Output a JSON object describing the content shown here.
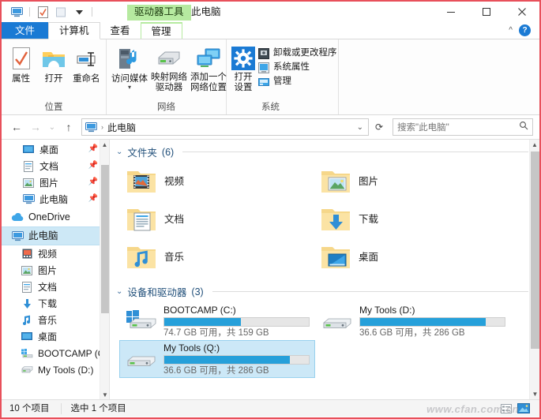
{
  "window": {
    "title": "此电脑",
    "contextual_tab_header": "驱动器工具",
    "accent_blue": "#1a7ad4",
    "contextual_green": "#b6eaa0",
    "selection_blue": "#cce8f7",
    "progress_blue": "#26a0da",
    "controls": {
      "minimize": "最小化",
      "maximize": "最大化",
      "close": "关闭"
    },
    "quick_access": [
      {
        "name": "this-pc-icon",
        "tooltip": "此电脑"
      },
      {
        "name": "properties-icon",
        "tooltip": "属性"
      },
      {
        "name": "new-folder-icon",
        "tooltip": "新建文件夹"
      },
      {
        "name": "customize-dropdown-icon",
        "tooltip": "自定义快速访问工具栏"
      }
    ]
  },
  "ribbon": {
    "tabs": [
      {
        "label": "文件",
        "state": "file"
      },
      {
        "label": "计算机",
        "state": "active"
      },
      {
        "label": "查看",
        "state": "normal"
      },
      {
        "label": "管理",
        "state": "contextual"
      }
    ],
    "collapse_label": "^",
    "help_label": "?",
    "groups": [
      {
        "label": "位置",
        "buttons": [
          {
            "label": "属性",
            "icon": "properties-icon"
          },
          {
            "label": "打开",
            "icon": "open-folder-icon"
          },
          {
            "label": "重命名",
            "icon": "rename-icon"
          }
        ]
      },
      {
        "label": "网络",
        "buttons": [
          {
            "label": "访问媒体",
            "label2": "",
            "icon": "access-media-icon",
            "has_caret": true
          },
          {
            "label": "映射网络",
            "label2": "驱动器",
            "icon": "map-network-drive-icon",
            "has_caret": true
          },
          {
            "label": "添加一个",
            "label2": "网络位置",
            "icon": "add-network-location-icon",
            "has_caret": false
          }
        ]
      },
      {
        "label": "系统",
        "big_button": {
          "label": "打开",
          "label2": "设置",
          "icon": "settings-gear-icon"
        },
        "small_items": [
          {
            "label": "卸载或更改程序",
            "icon": "uninstall-program-icon"
          },
          {
            "label": "系统属性",
            "icon": "system-properties-icon"
          },
          {
            "label": "管理",
            "icon": "manage-icon"
          }
        ]
      }
    ]
  },
  "address_bar": {
    "back": "后退",
    "forward": "前进",
    "recent": "最近浏览的位置",
    "up": "向上",
    "crumb_icon": "this-pc-icon",
    "crumb": "此电脑",
    "crumb_separator": "›",
    "dropdown": "⌄",
    "refresh": "刷新",
    "search_placeholder": "搜索\"此电脑\"",
    "search_icon": "search-icon"
  },
  "sidebar": {
    "items": [
      {
        "label": "桌面",
        "icon": "desktop-icon",
        "pinned": true,
        "level": 1,
        "selected": false
      },
      {
        "label": "文档",
        "icon": "documents-icon",
        "pinned": true,
        "level": 1,
        "selected": false
      },
      {
        "label": "图片",
        "icon": "pictures-icon",
        "pinned": true,
        "level": 1,
        "selected": false
      },
      {
        "label": "此电脑",
        "icon": "this-pc-icon",
        "pinned": true,
        "level": 1,
        "selected": false
      },
      {
        "label": "OneDrive",
        "icon": "onedrive-icon",
        "pinned": false,
        "level": 0,
        "selected": false
      },
      {
        "label": "此电脑",
        "icon": "this-pc-icon",
        "pinned": false,
        "level": 0,
        "selected": true
      },
      {
        "label": "视频",
        "icon": "videos-icon",
        "pinned": false,
        "level": 1,
        "selected": false
      },
      {
        "label": "图片",
        "icon": "pictures-icon",
        "pinned": false,
        "level": 1,
        "selected": false
      },
      {
        "label": "文档",
        "icon": "documents-icon",
        "pinned": false,
        "level": 1,
        "selected": false
      },
      {
        "label": "下载",
        "icon": "downloads-icon",
        "pinned": false,
        "level": 1,
        "selected": false
      },
      {
        "label": "音乐",
        "icon": "music-icon",
        "pinned": false,
        "level": 1,
        "selected": false
      },
      {
        "label": "桌面",
        "icon": "desktop-icon",
        "pinned": false,
        "level": 1,
        "selected": false
      },
      {
        "label": "BOOTCAMP (C",
        "icon": "windows-drive-icon",
        "pinned": false,
        "level": 1,
        "selected": false
      },
      {
        "label": "My Tools (D:)",
        "icon": "drive-icon",
        "pinned": false,
        "level": 1,
        "selected": false
      }
    ]
  },
  "content": {
    "folders_group": {
      "chevron": "⌄",
      "title": "文件夹",
      "count": "(6)",
      "items": [
        {
          "label": "视频",
          "icon": "videos-folder-icon"
        },
        {
          "label": "图片",
          "icon": "pictures-folder-icon"
        },
        {
          "label": "文档",
          "icon": "documents-folder-icon"
        },
        {
          "label": "下载",
          "icon": "downloads-folder-icon"
        },
        {
          "label": "音乐",
          "icon": "music-folder-icon"
        },
        {
          "label": "桌面",
          "icon": "desktop-folder-icon"
        }
      ]
    },
    "drives_group": {
      "chevron": "⌄",
      "title": "设备和驱动器",
      "count": "(3)",
      "items": [
        {
          "name": "BOOTCAMP (C:)",
          "icon": "windows-drive-icon",
          "usage": "74.7 GB 可用，共 159 GB",
          "free_gb": 74.7,
          "total_gb": 159,
          "used_percent": 53,
          "selected": false
        },
        {
          "name": "My Tools (D:)",
          "icon": "drive-icon",
          "usage": "36.6 GB 可用，共 286 GB",
          "free_gb": 36.6,
          "total_gb": 286,
          "used_percent": 87,
          "selected": false
        },
        {
          "name": "My Tools (Q:)",
          "icon": "drive-icon",
          "usage": "36.6 GB 可用，共 286 GB",
          "free_gb": 36.6,
          "total_gb": 286,
          "used_percent": 87,
          "selected": true
        }
      ]
    }
  },
  "status_bar": {
    "item_count": "10 个项目",
    "selection": "选中 1 个项目",
    "view_icons": [
      {
        "name": "details-view-icon",
        "active": false
      },
      {
        "name": "large-icons-view-icon",
        "active": true
      }
    ]
  },
  "watermark": "www.cfan.com.cn"
}
